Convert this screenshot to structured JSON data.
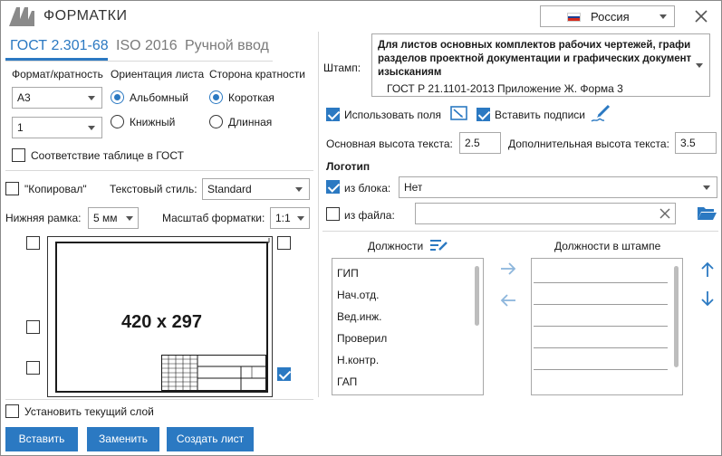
{
  "app": {
    "title": "ФОРМАТКИ"
  },
  "language": {
    "selected": "Россия",
    "flag_colors": [
      "#ffffff",
      "#1c3f94",
      "#d52b1e"
    ]
  },
  "window": {
    "close_icon": "close-icon"
  },
  "tabs": [
    {
      "label": "ГОСТ 2.301-68",
      "active": true
    },
    {
      "label": "ISO 2016",
      "active": false
    },
    {
      "label": "Ручной ввод",
      "active": false
    }
  ],
  "format": {
    "label": "Формат/кратность",
    "value": "А3",
    "multiplicity": "1"
  },
  "orientation": {
    "label": "Ориентация листа",
    "options": [
      {
        "label": "Альбомный",
        "selected": true
      },
      {
        "label": "Книжный",
        "selected": false
      }
    ]
  },
  "side": {
    "label": "Сторона кратности",
    "options": [
      {
        "label": "Короткая",
        "selected": true
      },
      {
        "label": "Длинная",
        "selected": false
      }
    ]
  },
  "gost_table": {
    "label": "Соответствие таблице в ГОСТ",
    "checked": false
  },
  "kopiroval": {
    "label": "\"Копировал\"",
    "checked": false
  },
  "text_style": {
    "label": "Текстовый стиль:",
    "value": "Standard"
  },
  "bottom_frame": {
    "label": "Нижняя рамка:",
    "value": "5 мм"
  },
  "scale": {
    "label": "Масштаб форматки:",
    "value": "1:1"
  },
  "preview": {
    "size_text": "420 x 297",
    "corner_checks": [
      false,
      false,
      false,
      false,
      true
    ]
  },
  "current_layer": {
    "label": "Установить текущий слой",
    "checked": false
  },
  "buttons": {
    "insert": "Вставить",
    "replace": "Заменить",
    "create": "Создать лист"
  },
  "stamp": {
    "label": "Штамп:",
    "line1": "Для листов основных комплектов рабочих чертежей, графи",
    "line2": "разделов проектной документации и графических документ",
    "line3": "изысканиям",
    "line4": "ГОСТ Р 21.1101-2013 Приложение Ж. Форма 3"
  },
  "use_fields": {
    "label": "Использовать поля",
    "checked": true
  },
  "insert_signatures": {
    "label": "Вставить подписи",
    "checked": true
  },
  "main_height": {
    "label": "Основная высота текста:",
    "value": "2.5"
  },
  "extra_height": {
    "label": "Дополнительная высота текста:",
    "value": "3.5"
  },
  "logo": {
    "heading": "Логотип",
    "from_block": {
      "label": "из блока:",
      "checked": true,
      "value": "Нет"
    },
    "from_file": {
      "label": "из файла:",
      "checked": false,
      "value": ""
    }
  },
  "positions": {
    "label": "Должности",
    "items": [
      "ГИП",
      "Нач.отд.",
      "Вед.инж.",
      "Проверил",
      "Н.контр.",
      "ГАП"
    ]
  },
  "stamp_positions": {
    "label": "Должности в штампе"
  },
  "accent_color": "#2b79c2"
}
